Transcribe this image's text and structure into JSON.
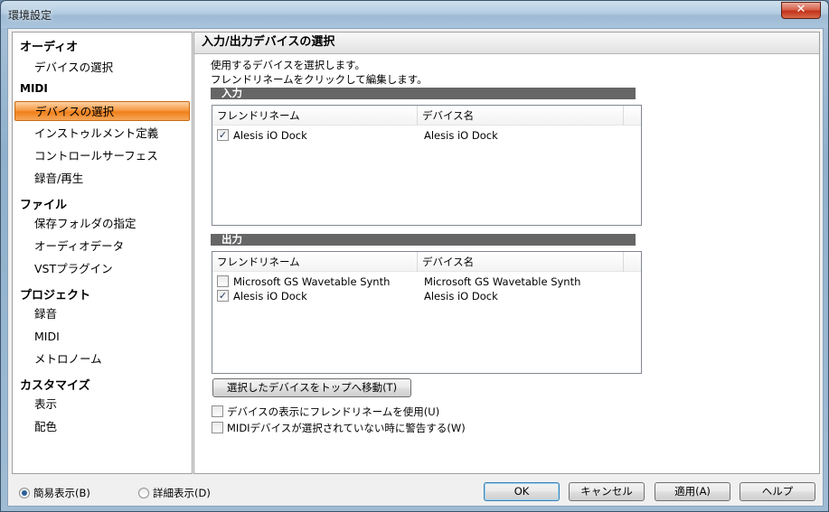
{
  "window": {
    "title": "環境設定",
    "close_label": "✕"
  },
  "sidebar": {
    "categories": [
      {
        "label": "オーディオ",
        "items": [
          "デバイスの選択"
        ]
      },
      {
        "label": "MIDI",
        "items": [
          "デバイスの選択",
          "インストゥルメント定義",
          "コントロールサーフェス",
          "録音/再生"
        ]
      },
      {
        "label": "ファイル",
        "items": [
          "保存フォルダの指定",
          "オーディオデータ",
          "VSTプラグイン"
        ]
      },
      {
        "label": "プロジェクト",
        "items": [
          "録音",
          "MIDI",
          "メトロノーム"
        ]
      },
      {
        "label": "カスタマイズ",
        "items": [
          "表示",
          "配色"
        ]
      }
    ],
    "selected": "MIDI/デバイスの選択"
  },
  "main": {
    "title": "入力/出力デバイスの選択",
    "desc1": "使用するデバイスを選択します。",
    "desc2": "フレンドリネームをクリックして編集します。",
    "input": {
      "section_label": "入力",
      "columns": [
        "フレンドリネーム",
        "デバイス名"
      ],
      "rows": [
        {
          "checked": true,
          "friendly": "Alesis iO Dock",
          "device": "Alesis iO Dock"
        }
      ]
    },
    "output": {
      "section_label": "出力",
      "columns": [
        "フレンドリネーム",
        "デバイス名"
      ],
      "rows": [
        {
          "checked": false,
          "friendly": "Microsoft GS Wavetable Synth",
          "device": "Microsoft GS Wavetable Synth"
        },
        {
          "checked": true,
          "friendly": "Alesis iO Dock",
          "device": "Alesis iO Dock"
        }
      ]
    },
    "move_top_button": "選択したデバイスをトップへ移動(T)",
    "options": [
      {
        "checked": false,
        "label": "デバイスの表示にフレンドリネームを使用(U)"
      },
      {
        "checked": false,
        "label": "MIDIデバイスが選択されていない時に警告する(W)"
      }
    ]
  },
  "footer": {
    "simple_view": "簡易表示(B)",
    "detail_view": "詳細表示(D)",
    "simple_selected": true,
    "ok": "OK",
    "cancel": "キャンセル",
    "apply": "適用(A)",
    "help": "ヘルプ"
  },
  "icons": {
    "check": "✓"
  }
}
